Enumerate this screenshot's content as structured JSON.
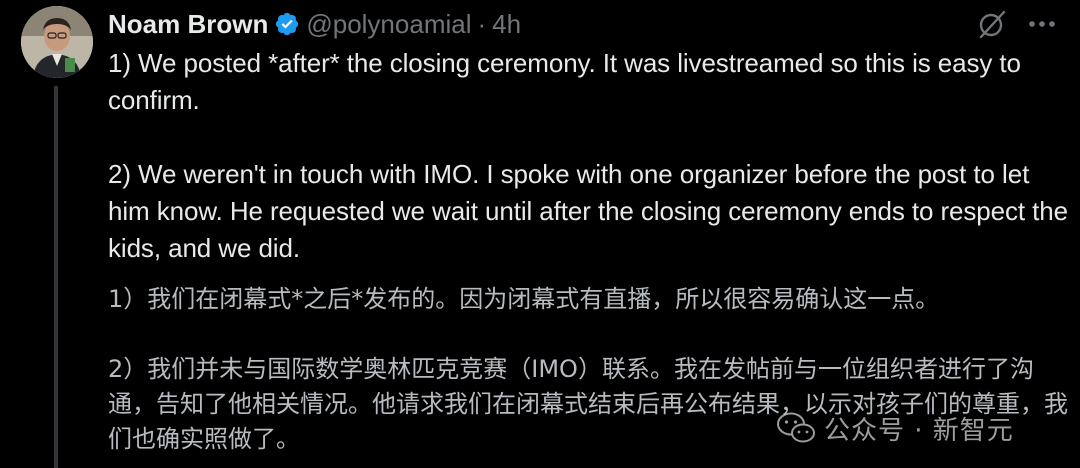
{
  "tweet": {
    "author": {
      "display_name": "Noam Brown",
      "handle": "@polynoamial",
      "separator": "·",
      "timestamp": "4h",
      "verified": true
    },
    "body_en": {
      "p1": "1) We posted *after* the closing ceremony. It was livestreamed so this is easy to confirm.",
      "p2": "2) We weren't in touch with IMO. I spoke with one organizer before the post to let him know. He requested we wait until after the closing ceremony ends to respect the kids, and we did."
    },
    "body_zh": {
      "p1": "1）我们在闭幕式*之后*发布的。因为闭幕式有直播，所以很容易确认这一点。",
      "p2": "2）我们并未与国际数学奥林匹克竞赛（IMO）联系。我在发帖前与一位组织者进行了沟通，告知了他相关情况。他请求我们在闭幕式结束后再公布结果，以示对孩子们的尊重，我们也确实照做了。"
    },
    "icons": {
      "verified": "verified-badge-icon",
      "grok": "grok-icon",
      "more": "more-options-icon"
    },
    "colors": {
      "background": "#000000",
      "primary_text": "#e7e9ea",
      "secondary_text": "#71767b",
      "verified_blue": "#1d9bf0"
    }
  },
  "watermark": {
    "text": "公众号 · 新智元"
  }
}
